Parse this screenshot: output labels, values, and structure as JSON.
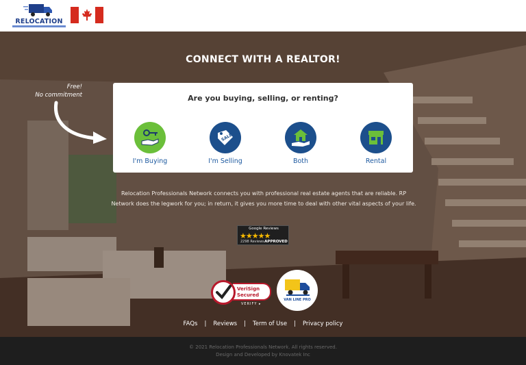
{
  "header": {
    "logo_text": "RELOCATION",
    "flag": "canada-flag"
  },
  "hero": {
    "title": "CONNECT WITH A REALTOR!",
    "free_line1": "Free!",
    "free_line2": "No commitment",
    "question": "Are you buying, selling, or renting?",
    "options": [
      {
        "label": "I'm Buying",
        "icon": "key-hand-icon",
        "color": "#6bbf3a"
      },
      {
        "label": "I'm Selling",
        "icon": "sale-tag-icon",
        "color": "#1c4f8c"
      },
      {
        "label": "Both",
        "icon": "house-hand-icon",
        "color": "#1c4f8c"
      },
      {
        "label": "Rental",
        "icon": "storefront-icon",
        "color": "#1c4f8c"
      }
    ],
    "description": "Relocation Professionals Network connects you with professional real estate agents that are reliable. RP Network does the legwork for you; in return, it gives you more time to deal with other vital aspects of your life."
  },
  "badges": {
    "google_title": "Google Reviews",
    "google_stars": "★★★★★",
    "google_count": "2298 Reviews",
    "google_approved": "APPROVED",
    "verisign_line1": "VeriSign",
    "verisign_line2": "Secured",
    "verisign_verify": "VERIFY ▸",
    "vanline_name": "VAN LINE PRO"
  },
  "footer": {
    "links": [
      "FAQs",
      "Reviews",
      "Term of Use",
      "Privacy policy"
    ],
    "copyright": "© 2021 Relocation Professionals Network. All rights reserved.",
    "developer": "Design and Developed by Knovatek Inc"
  }
}
